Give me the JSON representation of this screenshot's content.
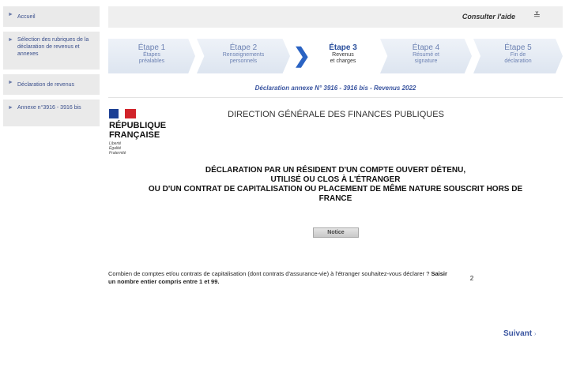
{
  "sidebar": {
    "items": [
      {
        "label": "Accueil"
      },
      {
        "label": "Sélection des rubriques de la déclaration de revenus et annexes"
      },
      {
        "label": "Déclaration de revenus"
      },
      {
        "label": "Annexe n°3916 - 3916 bis"
      }
    ]
  },
  "help": {
    "label": "Consulter l'aide"
  },
  "steps": [
    {
      "title": "Étape 1",
      "desc": "Étapes préalables"
    },
    {
      "title": "Étape 2",
      "desc": "Renseignements personnels"
    },
    {
      "title": "Étape 3",
      "desc": "Revenus et charges",
      "current": true
    },
    {
      "title": "Étape 4",
      "desc": "Résumé et signature"
    },
    {
      "title": "Étape 5",
      "desc": "Fin de déclaration"
    }
  ],
  "subtitle": "Déclaration annexe N° 3916 - 3916 bis - Revenus 2022",
  "logo": {
    "line1": "RÉPUBLIQUE",
    "line2": "FRANÇAISE",
    "motto1": "Liberté",
    "motto2": "Égalité",
    "motto3": "Fraternité"
  },
  "dgfip": "DIRECTION GÉNÉRALE DES FINANCES PUBLIQUES",
  "title": {
    "line1": "DÉCLARATION PAR UN RÉSIDENT D'UN COMPTE OUVERT DÉTENU,",
    "line2": "UTILISÉ OU CLOS À L'ÉTRANGER",
    "line3": "OU D'UN CONTRAT DE CAPITALISATION OU PLACEMENT DE MÊME NATURE SOUSCRIT HORS DE",
    "line4": "FRANCE"
  },
  "notice_label": "Notice",
  "question": {
    "text": "Combien de comptes et/ou contrats de capitalisation (dont contrats d'assurance-vie) à l'étranger souhaitez-vous déclarer ? ",
    "bold": "Saisir un nombre entier compris entre 1 et 99."
  },
  "answer_value": "2",
  "next_label": "Suivant",
  "colors": {
    "accent": "#2a63c3",
    "link": "#3a55a0",
    "flag_blue": "#1c3f94",
    "flag_red": "#d1232a"
  }
}
